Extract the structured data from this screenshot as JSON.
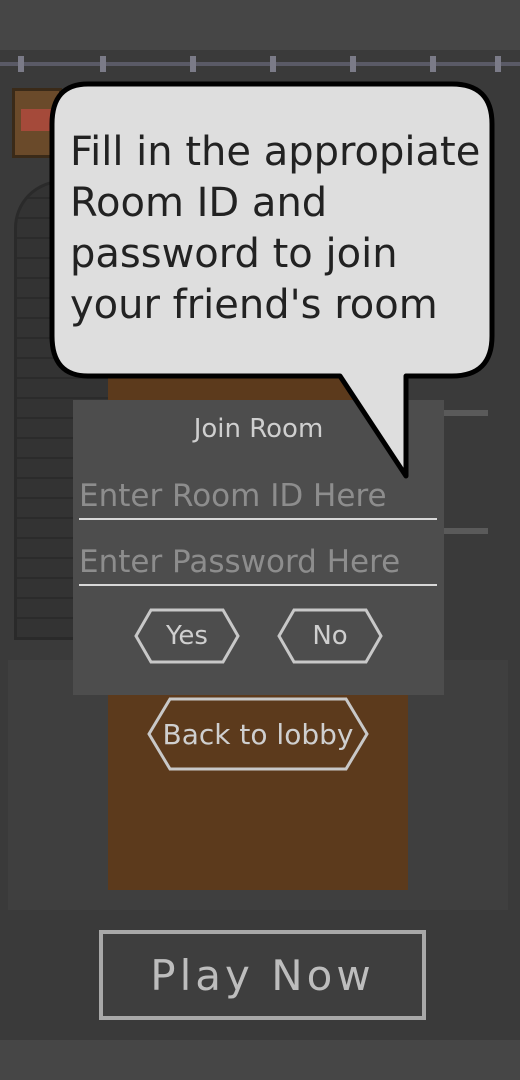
{
  "tutorial": {
    "message": "Fill in the appropiate Room ID and password to join your friend's room"
  },
  "join_room": {
    "title": "Join Room",
    "room_id_placeholder": "Enter Room ID Here",
    "password_placeholder": "Enter Password Here",
    "yes_label": "Yes",
    "no_label": "No"
  },
  "lobby": {
    "back_label": "Back to lobby"
  },
  "play": {
    "label": "Play Now"
  },
  "colors": {
    "background": "#464646",
    "dialog": "#4d4d4d",
    "wood": "#5c3a1c",
    "button_outline": "#c8c8c8"
  }
}
